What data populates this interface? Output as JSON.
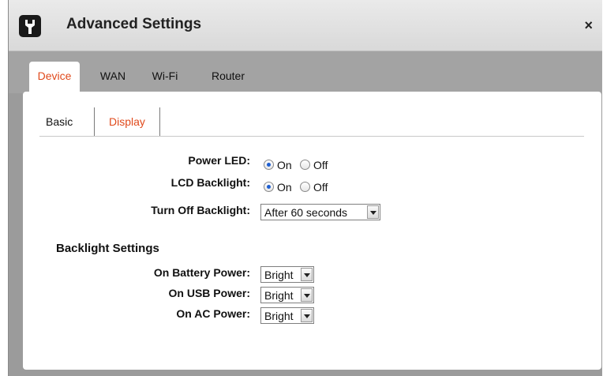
{
  "window": {
    "title": "Advanced Settings",
    "close_symbol": "×",
    "icon": "wrench-icon"
  },
  "main_tabs": [
    {
      "label": "Device",
      "active": true
    },
    {
      "label": "WAN",
      "active": false
    },
    {
      "label": "Wi-Fi",
      "active": false
    },
    {
      "label": "Router",
      "active": false
    }
  ],
  "sub_tabs": [
    {
      "label": "Basic",
      "active": false
    },
    {
      "label": "Display",
      "active": true
    }
  ],
  "display": {
    "power_led": {
      "label": "Power LED:",
      "on": "On",
      "off": "Off",
      "selected": "On"
    },
    "lcd_backlight": {
      "label": "LCD Backlight:",
      "on": "On",
      "off": "Off",
      "selected": "On"
    },
    "turn_off_backlight": {
      "label": "Turn Off Backlight:",
      "value": "After 60 seconds"
    }
  },
  "backlight_settings": {
    "title": "Backlight Settings",
    "battery": {
      "label": "On Battery Power:",
      "value": "Bright"
    },
    "usb": {
      "label": "On USB Power:",
      "value": "Bright"
    },
    "ac": {
      "label": "On AC Power:",
      "value": "Bright"
    }
  },
  "colors": {
    "accent": "#e04a1c",
    "radio_dot": "#1f5fd1"
  }
}
